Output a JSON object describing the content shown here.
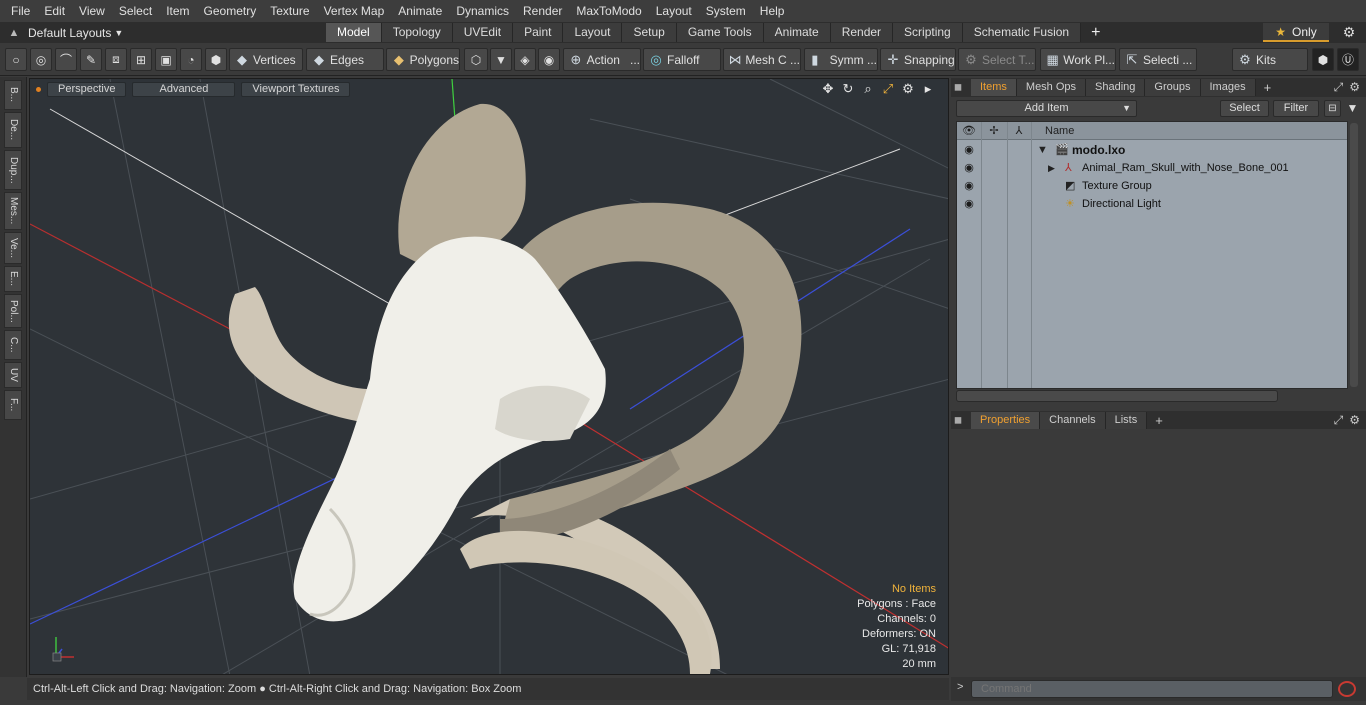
{
  "menu": [
    "File",
    "Edit",
    "View",
    "Select",
    "Item",
    "Geometry",
    "Texture",
    "Vertex Map",
    "Animate",
    "Dynamics",
    "Render",
    "MaxToModo",
    "Layout",
    "System",
    "Help"
  ],
  "layouts_label": "Default Layouts",
  "tabs": [
    "Model",
    "Topology",
    "UVEdit",
    "Paint",
    "Layout",
    "Setup",
    "Game Tools",
    "Animate",
    "Render",
    "Scripting",
    "Schematic Fusion"
  ],
  "only_label": "Only",
  "toolbar": {
    "vertices": "Vertices",
    "edges": "Edges",
    "polygons": "Polygons",
    "action": "Action",
    "falloff": "Falloff",
    "mesh": "Mesh C ...",
    "symm": "Symm ...",
    "snapping": "Snapping",
    "select_t": "Select T...",
    "work_pl": "Work Pl...",
    "selecti": "Selecti ...",
    "kits": "Kits"
  },
  "left_tabs": [
    "B...",
    "De...",
    "Dup...",
    "Mes...",
    "Ve...",
    "E...",
    "Pol...",
    "C...",
    "UV",
    "F..."
  ],
  "viewport": {
    "perspective": "Perspective",
    "advanced": "Advanced",
    "viewport_textures": "Viewport Textures",
    "info": {
      "no_items": "No Items",
      "polygons": "Polygons : Face",
      "channels": "Channels: 0",
      "deformers": "Deformers: ON",
      "gl": "GL: 71,918",
      "scale": "20 mm"
    }
  },
  "status_text": "Ctrl-Alt-Left Click and Drag: Navigation: Zoom ● Ctrl-Alt-Right Click and Drag: Navigation: Box Zoom",
  "items_panel": {
    "tabs": [
      "Items",
      "Mesh Ops",
      "Shading",
      "Groups",
      "Images"
    ],
    "add_item": "Add Item",
    "select": "Select",
    "filter": "Filter",
    "col_name": "Name",
    "rows": [
      {
        "label": "modo.lxo"
      },
      {
        "label": "Animal_Ram_Skull_with_Nose_Bone_001"
      },
      {
        "label": "Texture Group"
      },
      {
        "label": "Directional Light"
      }
    ]
  },
  "props_panel": {
    "tabs": [
      "Properties",
      "Channels",
      "Lists"
    ]
  },
  "command_placeholder": "Command",
  "colors": {
    "accent_orange": "#f0a030",
    "tree_bg": "#9ba4ad",
    "viewport_bg": "#2e3338"
  }
}
